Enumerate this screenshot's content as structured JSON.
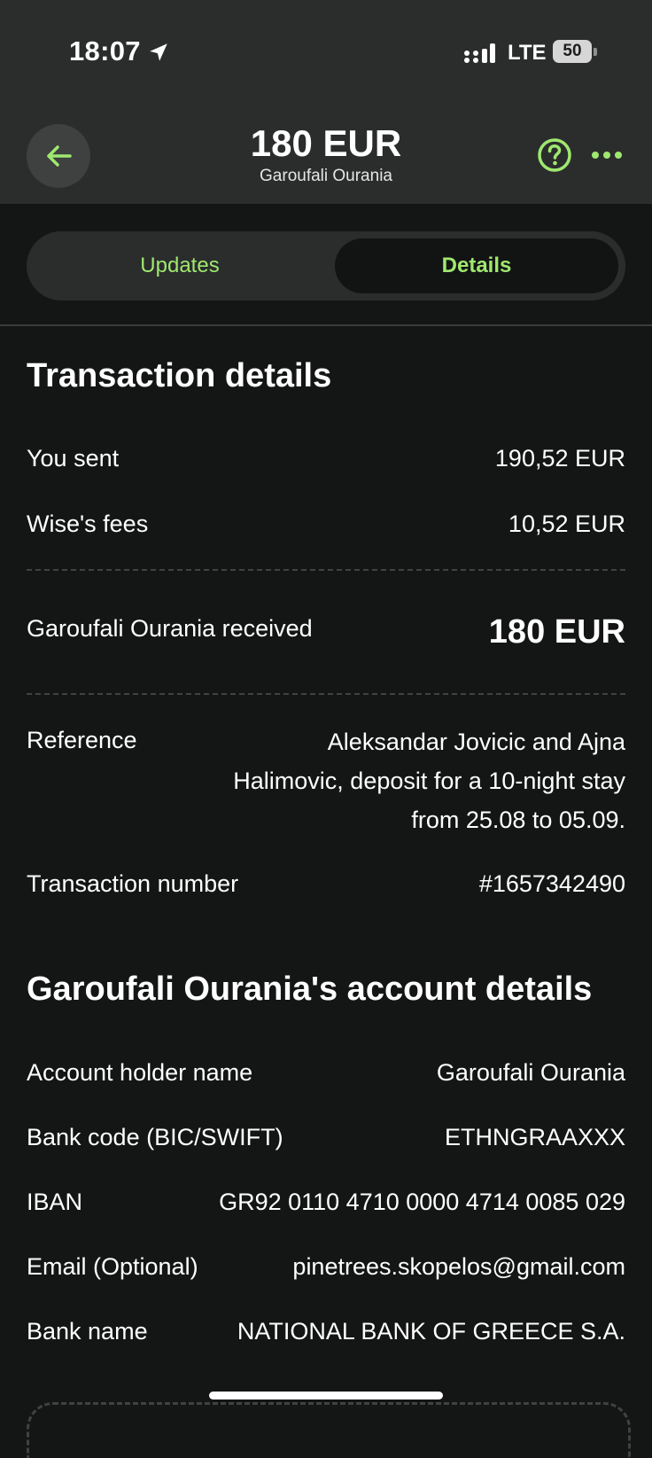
{
  "status_bar": {
    "time": "18:07",
    "network": "LTE",
    "battery": "50"
  },
  "header": {
    "title": "180 EUR",
    "subtitle": "Garoufali Ourania"
  },
  "tabs": [
    {
      "label": "Updates"
    },
    {
      "label": "Details"
    }
  ],
  "transaction": {
    "title": "Transaction details",
    "sent_label": "You sent",
    "sent_value": "190,52 EUR",
    "fees_label": "Wise's fees",
    "fees_value": "10,52 EUR",
    "received_label": "Garoufali Ourania received",
    "received_value": "180 EUR",
    "reference_label": "Reference",
    "reference_lines": [
      "Aleksandar Jovicic and Ajna",
      "Halimovic, deposit for a 10-night stay",
      "from 25.08 to 05.09."
    ],
    "number_label": "Transaction number",
    "number_value": "#1657342490"
  },
  "account": {
    "title": "Garoufali Ourania's account details",
    "holder_label": "Account holder name",
    "holder_value": "Garoufali Ourania",
    "bic_label": "Bank code (BIC/SWIFT)",
    "bic_value": "ETHNGRAAXXX",
    "iban_label": "IBAN",
    "iban_value": "GR92 0110 4710 0000 4714 0085 029",
    "email_label": "Email (Optional)",
    "email_value": "pinetrees.skopelos@gmail.com",
    "bank_label": "Bank name",
    "bank_value": "NATIONAL BANK OF GREECE S.A."
  },
  "colors": {
    "accent": "#9fe870",
    "background": "#141615",
    "header": "#2b2d2c"
  },
  "icons": [
    "location-arrow-icon",
    "signal-icon",
    "battery-icon",
    "back-arrow-icon",
    "help-icon",
    "more-icon"
  ]
}
